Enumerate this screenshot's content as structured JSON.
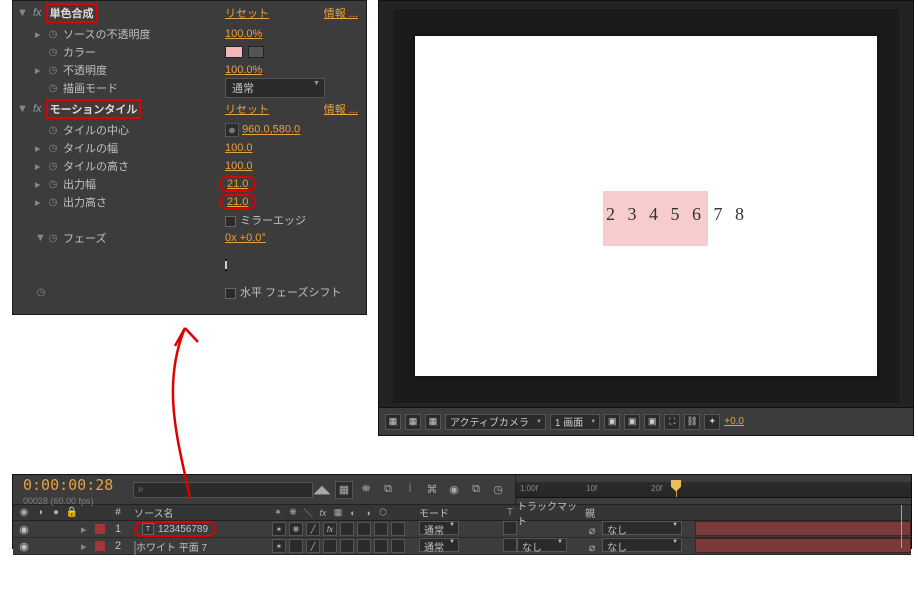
{
  "effects": {
    "fx_label": "fx",
    "reset": "リセット",
    "info": "情報 ...",
    "effect1": {
      "name": "単色合成",
      "props": {
        "source_opacity": {
          "label": "ソースの不透明度",
          "value": "100.0%"
        },
        "color": {
          "label": "カラー"
        },
        "opacity": {
          "label": "不透明度",
          "value": "100.0%"
        },
        "blend_mode": {
          "label": "描画モード",
          "value": "通常"
        }
      }
    },
    "effect2": {
      "name": "モーションタイル",
      "props": {
        "center": {
          "label": "タイルの中心",
          "value": "960.0,580.0"
        },
        "width": {
          "label": "タイルの幅",
          "value": "100.0"
        },
        "height": {
          "label": "タイルの高さ",
          "value": "100.0"
        },
        "out_width": {
          "label": "出力幅",
          "value": "21.0"
        },
        "out_height": {
          "label": "出力高さ",
          "value": "21.0"
        },
        "mirror": {
          "label": "ミラーエッジ"
        },
        "phase": {
          "label": "フェーズ",
          "value": "0x +0.0°"
        },
        "phase_shift": {
          "label": "水平 フェーズシフト"
        }
      }
    }
  },
  "preview": {
    "text": "2 3 4 5 6 7 8",
    "toolbar": {
      "camera": "アクティブカメラ",
      "views": "1 画面",
      "exposure": "+0.0"
    }
  },
  "timeline": {
    "timecode": "0:00:00:28",
    "subtime": "00028 (60.00 fps)",
    "ruler": {
      "r1": "1:00f",
      "r2": "10f",
      "r3": "20f"
    },
    "cols": {
      "num": "#",
      "source": "ソース名",
      "mode": "モード",
      "t": "T",
      "track": "トラックマット",
      "parent": "親"
    },
    "layers": [
      {
        "num": "1",
        "name": "123456789",
        "mode": "通常",
        "track": "",
        "parent": "なし",
        "icon": "text"
      },
      {
        "num": "2",
        "name": "ホワイト 平面 7",
        "mode": "通常",
        "track": "なし",
        "parent": "なし",
        "icon": "solid"
      }
    ]
  }
}
